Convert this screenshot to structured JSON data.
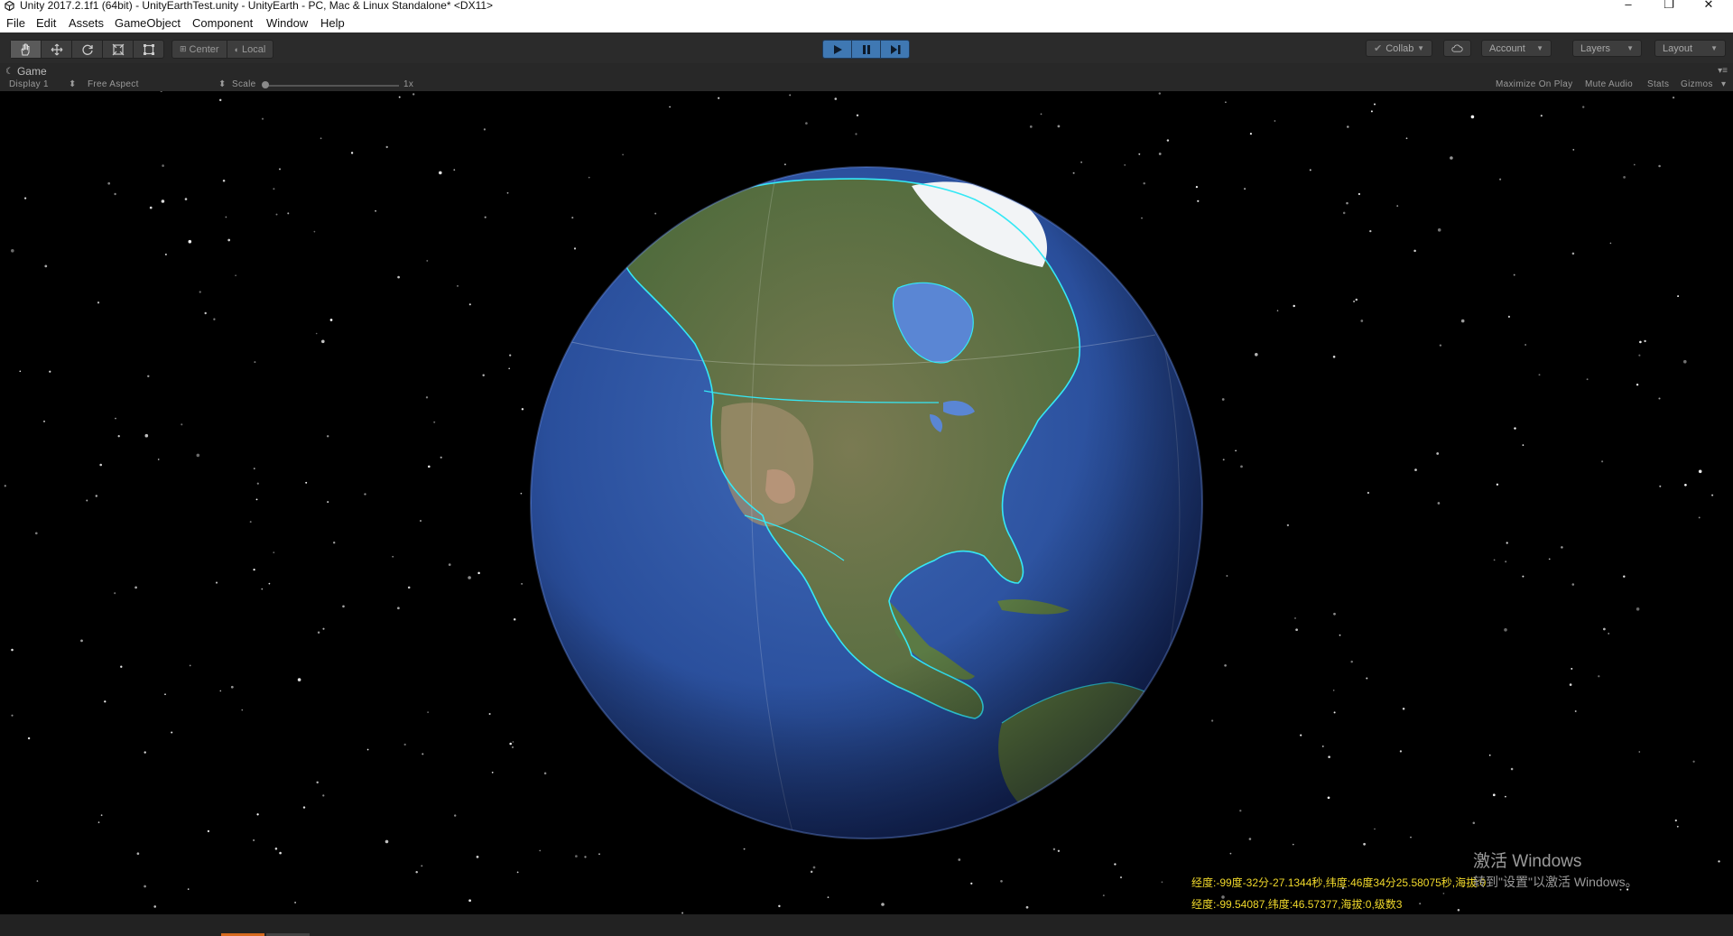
{
  "window": {
    "title": "Unity 2017.2.1f1 (64bit) - UnityEarthTest.unity - UnityEarth - PC, Mac & Linux Standalone* <DX11>",
    "controls": {
      "minimize": "–",
      "restore": "❐",
      "close": "✕"
    }
  },
  "menu": [
    "File",
    "Edit",
    "Assets",
    "GameObject",
    "Component",
    "Window",
    "Help"
  ],
  "toolbar": {
    "tools": [
      "hand-icon",
      "move-icon",
      "rotate-icon",
      "scale-icon",
      "rect-icon"
    ],
    "pivot_mode": "Center",
    "pivot_rotation": "Local",
    "collab": "Collab",
    "account": "Account",
    "layers": "Layers",
    "layout": "Layout"
  },
  "game_view": {
    "tab": "Game",
    "display": "Display 1",
    "aspect": "Free Aspect",
    "scale_label": "Scale",
    "scale_value": "1x",
    "maximize_on_play": "Maximize On Play",
    "mute_audio": "Mute Audio",
    "stats": "Stats",
    "gizmos": "Gizmos"
  },
  "overlay": {
    "coord_dms": "经度:-99度-32分-27.1344秒,纬度:46度34分25.58075秒,海拔:0",
    "coord_decimal": "经度:-99.54087,纬度:46.57377,海拔:0,级数3",
    "activation_title": "激活 Windows",
    "activation_hint": "转到\"设置\"以激活 Windows。"
  },
  "colors": {
    "accent_play": "#3f78b3",
    "coord_text": "#f1d92b",
    "boundary_glow": "#35e8f5",
    "ocean": "#2a4f9c"
  }
}
